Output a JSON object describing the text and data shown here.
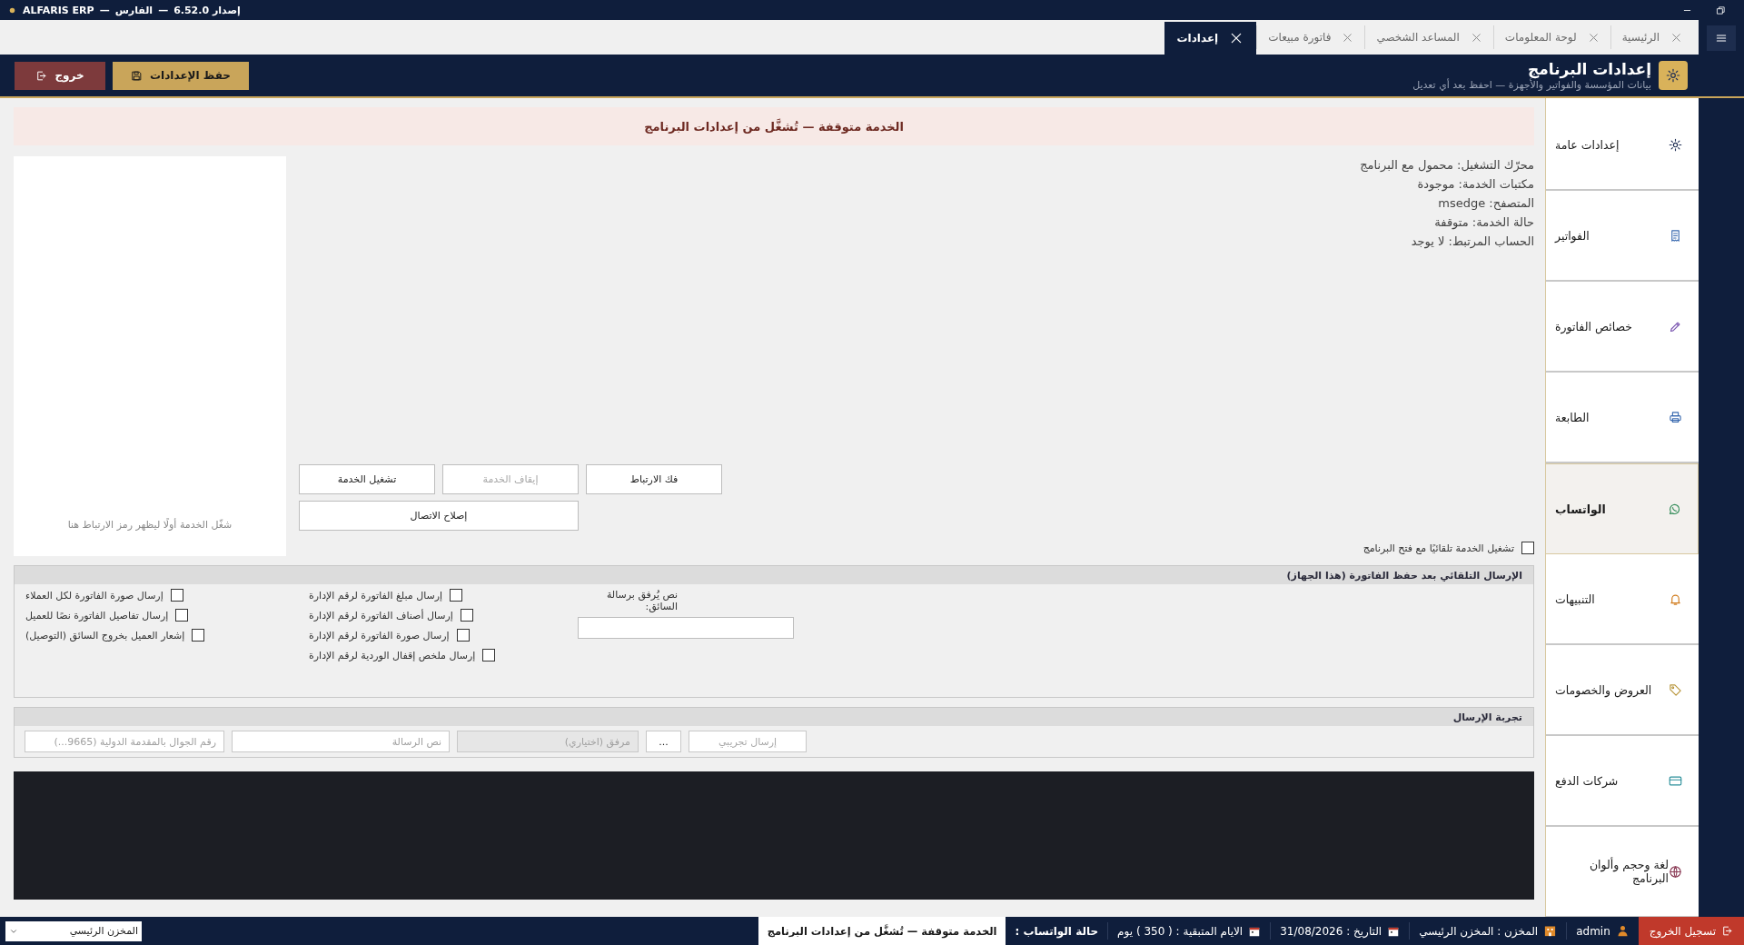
{
  "title_bar": {
    "app_name": "ALFARIS ERP",
    "separator_1": "—",
    "app_name_arabic": "الفارس",
    "separator_2": "—",
    "version": "إصدار 6.52.0"
  },
  "tabs": [
    {
      "label": "الرئيسية",
      "selected": false
    },
    {
      "label": "لوحة المعلومات",
      "selected": false
    },
    {
      "label": "المساعد الشخصي",
      "selected": false
    },
    {
      "label": "فاتورة مبيعات",
      "selected": false
    },
    {
      "label": "إعدادات",
      "selected": true
    }
  ],
  "header": {
    "title": "إعدادات البرنامج",
    "subtitle": "بيانات المؤسسة والفواتير والأجهزة — احفظ بعد أي تعديل",
    "buttons": [
      {
        "label": "حفظ الإعدادات",
        "kind": "save"
      },
      {
        "label": "خروج",
        "kind": "exit"
      }
    ]
  },
  "sidebar": {
    "items": [
      {
        "label": "إعدادات عامة",
        "selected": false
      },
      {
        "label": "الفواتير",
        "selected": false
      },
      {
        "label": "خصائص الفاتورة",
        "selected": false
      },
      {
        "label": "الطابعة",
        "selected": false
      },
      {
        "label": "الواتساب",
        "selected": true
      },
      {
        "label": "التنبيهات",
        "selected": false
      },
      {
        "label": "العروض والخصومات",
        "selected": false
      },
      {
        "label": "شركات الدفع",
        "selected": false
      },
      {
        "label": "لغة وحجم وألوان البرنامج",
        "selected": false
      }
    ]
  },
  "banner": {
    "message": "الخدمة متوقفة — تُشغَّل من إعدادات البرنامج"
  },
  "qr_panel": {
    "hint": "شغّل الخدمة أولًا ليظهر رمز الارتباط هنا"
  },
  "service_info": [
    "محرّك التشغيل: محمول مع البرنامج",
    "مكتبات الخدمة: موجودة",
    "المتصفح: msedge",
    "حالة الخدمة: متوقفة",
    "الحساب المرتبط: لا يوجد"
  ],
  "service_buttons": [
    {
      "label": "فك الارتباط",
      "disabled": false
    },
    {
      "label": "إيقاف الخدمة",
      "disabled": true
    },
    {
      "label": "تشغيل الخدمة",
      "disabled": false
    },
    {
      "label": "إصلاح الاتصال",
      "disabled": false
    }
  ],
  "auto_start": {
    "label": "تشغيل الخدمة تلقائيًا مع فتح البرنامج",
    "checked": false
  },
  "auto_send": {
    "title": "الإرسال التلقائي بعد حفظ الفاتورة (هذا الجهاز)",
    "driver_text": {
      "label": "نص يُرفق برسالة السائق:"
    },
    "admin_options": [
      {
        "label": "إرسال مبلغ الفاتورة لرقم الإدارة",
        "checked": false
      },
      {
        "label": "إرسال أصناف الفاتورة لرقم الإدارة",
        "checked": false
      },
      {
        "label": "إرسال صورة الفاتورة لرقم الإدارة",
        "checked": false
      },
      {
        "label": "إرسال ملخص إقفال الوردية لرقم الإدارة",
        "checked": false
      }
    ],
    "customer_options": [
      {
        "label": "إرسال صورة الفاتورة لكل العملاء",
        "checked": false
      },
      {
        "label": "إرسال تفاصيل الفاتورة نصًا للعميل",
        "checked": false
      },
      {
        "label": "إشعار العميل بخروج السائق (التوصيل)",
        "checked": false
      }
    ]
  },
  "test_send": {
    "title": "تجربة الإرسال",
    "send_button": {
      "label": "إرسال تجريبي",
      "disabled": true
    },
    "browse_button": {
      "label": "..."
    },
    "attachment": {
      "placeholder": "مرفق (اختياري)",
      "disabled": true
    },
    "message": {
      "placeholder": "نص الرسالة"
    },
    "phone": {
      "placeholder": "رقم الجوال بالمقدمة الدولية (9665...)"
    }
  },
  "status_bar": {
    "warehouse_select": {
      "value": "المخزن الرئيسي"
    },
    "logout": {
      "label": "تسجيل الخروج"
    },
    "user": "admin",
    "warehouse": "المخزن : المخزن الرئيسي",
    "date": "التاريخ : 31/08/2026",
    "days_left": "الايام المتبقية : ( 350 ) يوم",
    "whatsapp_label": "حالة الواتساب :",
    "whatsapp_status": "الخدمة متوقفة — تُشغَّل من إعدادات البرنامج"
  }
}
